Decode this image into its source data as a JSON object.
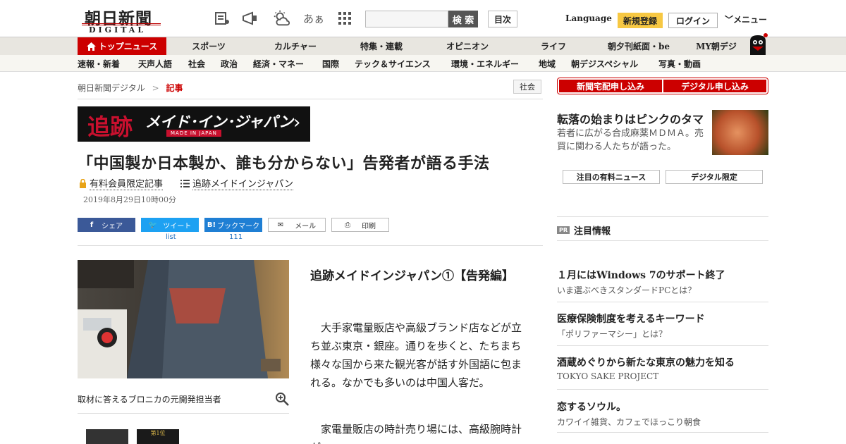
{
  "header": {
    "logo_text": "朝日新聞",
    "logo_sub": "DIGITAL",
    "search_label": "検 索",
    "toc_label": "目次",
    "language_label": "Language",
    "register_label": "新規登録",
    "login_label": "ログイン",
    "menu_label": "メニュー",
    "font_icon_text": "あぁ"
  },
  "nav_primary": [
    {
      "label": "トップニュース"
    },
    {
      "label": "スポーツ"
    },
    {
      "label": "カルチャー"
    },
    {
      "label": "特集・連載"
    },
    {
      "label": "オピニオン"
    },
    {
      "label": "ライフ"
    },
    {
      "label": "朝夕刊紙面・be"
    },
    {
      "label": "MY朝デジ"
    }
  ],
  "nav_secondary": [
    {
      "label": "速報・新着"
    },
    {
      "label": "天声人語"
    },
    {
      "label": "社会"
    },
    {
      "label": "政治"
    },
    {
      "label": "経済・マネー"
    },
    {
      "label": "国際"
    },
    {
      "label": "テック＆サイエンス"
    },
    {
      "label": "環境・エネルギー"
    },
    {
      "label": "地域"
    },
    {
      "label": "朝デジスペシャル"
    },
    {
      "label": "写真・動画"
    }
  ],
  "breadcrumb": {
    "home": "朝日新聞デジタル",
    "separator": ">",
    "current": "記事"
  },
  "category_tag": "社会",
  "banner": {
    "kanji": "追跡",
    "title": "メイド･イン･ジャパン",
    "subtitle": "MADE IN JAPAN"
  },
  "article": {
    "headline": "「中国製か日本製か、誰も分からない」告発者が語る手法",
    "members_badge": "有料会員限定記事",
    "series_link": "追跡メイドインジャパン",
    "date": "2019年8月29日10時00分",
    "photo_caption": "取材に答えるブロニカの元開発担当者",
    "subtitle": "追跡メイドインジャパン①【告発編】",
    "paragraphs": [
      "大手家電量販店や高級ブランド店などが立ち並ぶ東京・銀座。通りを歩くと、たちまち様々な国から来た観光客が話す外国語に包まれる。なかでも多いのは中国人客だ。",
      "家電量販店の時計売り場には、高級腕時計が"
    ],
    "thumb2_text": "第1位"
  },
  "share": {
    "facebook": "シェア",
    "twitter": "ツイート",
    "hatena": "ブックマーク",
    "mail": "メール",
    "print": "印刷",
    "twitter_count": "list",
    "hatena_count": "111"
  },
  "sidebar": {
    "subscribe_paper": "新聞宅配申し込み",
    "subscribe_digital": "デジタル申し込み",
    "feature_title": "転落の始まりはピンクのタマ",
    "feature_desc": "若者に広がる合成麻薬ＭＤＭＡ。売買に関わる人たちが語った。",
    "btn_paid_news": "注目の有料ニュース",
    "btn_digital_only": "デジタル限定",
    "pr_icon": "PR",
    "pr_heading": "注目情報",
    "ads": [
      {
        "title": "１月にはWindows 7のサポート終了",
        "desc": "いま選ぶべきスタンダードPCとは？"
      },
      {
        "title": "医療保険制度を考えるキーワード",
        "desc": "「ポリファーマシー」とは？"
      },
      {
        "title": "酒蔵めぐりから新たな東京の魅力を知る",
        "desc": "TOKYO SAKE PROJECT"
      },
      {
        "title": "恋するソウル。",
        "desc": "カワイイ雑貨、カフェでほっこり朝食"
      }
    ]
  }
}
